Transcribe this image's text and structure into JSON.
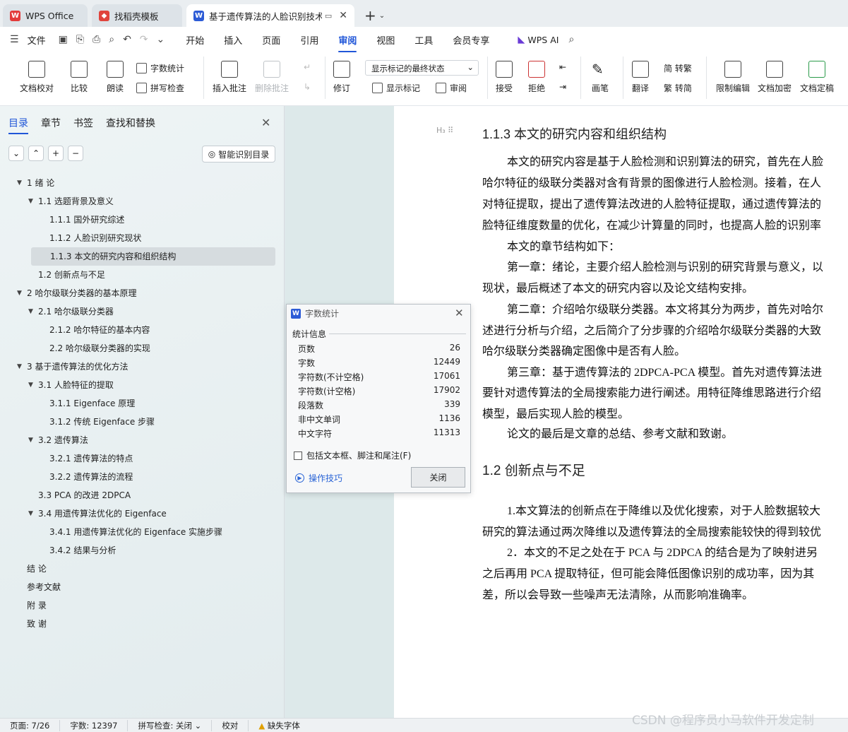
{
  "tabs": [
    {
      "label": "WPS Office"
    },
    {
      "label": "找稻壳模板"
    },
    {
      "label": "基于遗传算法的人脸识别技术"
    }
  ],
  "menu": {
    "file": "文件",
    "items": [
      "开始",
      "插入",
      "页面",
      "引用",
      "审阅",
      "视图",
      "工具",
      "会员专享"
    ],
    "active": "审阅",
    "wps_ai": "WPS AI"
  },
  "ribbon": {
    "doc_check": "文档校对",
    "compare": "比较",
    "read_aloud": "朗读",
    "word_count": "字数统计",
    "spell_check": "拼写检查",
    "insert_comment": "插入批注",
    "delete_comment": "删除批注",
    "revise": "修订",
    "markup_state": "显示标记的最终状态",
    "show_markup": "显示标记",
    "review": "审阅",
    "accept": "接受",
    "reject": "拒绝",
    "pen": "画笔",
    "translate": "翻译",
    "trad": "简 转繁",
    "simp": "繁 转简",
    "restrict": "限制编辑",
    "encrypt": "文档加密",
    "finalize": "文档定稿"
  },
  "sidebar": {
    "tabs": [
      "目录",
      "章节",
      "书签",
      "查找和替换"
    ],
    "smart_toc": "智能识别目录",
    "toc": [
      {
        "label": "1 绪 论",
        "level": 0,
        "arrow": true
      },
      {
        "label": "1.1 选题背景及意义",
        "level": 1,
        "arrow": true
      },
      {
        "label": "1.1.1 国外研究综述",
        "level": 2
      },
      {
        "label": "1.1.2 人脸识别研究现状",
        "level": 2
      },
      {
        "label": "1.1.3 本文的研究内容和组织结构",
        "level": 2,
        "selected": true
      },
      {
        "label": "1.2 创新点与不足",
        "level": 1
      },
      {
        "label": "2 哈尔级联分类器的基本原理",
        "level": 0,
        "arrow": true
      },
      {
        "label": "2.1 哈尔级联分类器",
        "level": 1,
        "arrow": true
      },
      {
        "label": "2.1.2 哈尔特征的基本内容",
        "level": 2
      },
      {
        "label": "2.2 哈尔级联分类器的实现",
        "level": 2
      },
      {
        "label": "3 基于遗传算法的优化方法",
        "level": 0,
        "arrow": true
      },
      {
        "label": "3.1 人脸特征的提取",
        "level": 1,
        "arrow": true
      },
      {
        "label": "3.1.1 Eigenface 原理",
        "level": 2
      },
      {
        "label": "3.1.2 传统 Eigenface 步骤",
        "level": 2
      },
      {
        "label": "3.2 遗传算法",
        "level": 1,
        "arrow": true
      },
      {
        "label": "3.2.1 遗传算法的特点",
        "level": 2
      },
      {
        "label": "3.2.2 遗传算法的流程",
        "level": 2
      },
      {
        "label": "3.3 PCA 的改进 2DPCA",
        "level": 1
      },
      {
        "label": "3.4 用遗传算法优化的 Eigenface",
        "level": 1,
        "arrow": true
      },
      {
        "label": "3.4.1 用遗传算法优化的 Eigenface 实施步骤",
        "level": 2
      },
      {
        "label": "3.4.2 结果与分析",
        "level": 2
      },
      {
        "label": "结 论",
        "level": 0
      },
      {
        "label": "参考文献",
        "level": 0
      },
      {
        "label": "附 录",
        "level": 0
      },
      {
        "label": "致 谢",
        "level": 0
      }
    ]
  },
  "document": {
    "heading1": "1.1.3 本文的研究内容和组织结构",
    "para1": [
      "本文的研究内容是基于人脸检测和识别算法的研究，首先在人脸",
      "哈尔特征的级联分类器对含有背景的图像进行人脸检测。接着，在人",
      "对特征提取，提出了遗传算法改进的人脸特征提取，通过遗传算法的",
      "脸特征维度数量的优化，在减少计算量的同时，也提高人脸的识别率"
    ],
    "para2": "本文的章节结构如下：",
    "para3": [
      "第一章：绪论，主要介绍人脸检测与识别的研究背景与意义，以",
      "现状，最后概述了本文的研究内容以及论文结构安排。"
    ],
    "para4": [
      "第二章：介绍哈尔级联分类器。本文将其分为两步，首先对哈尔",
      "述进行分析与介绍，之后简介了分步骤的介绍哈尔级联分类器的大致",
      "哈尔级联分类器确定图像中是否有人脸。"
    ],
    "para5": [
      "第三章：基于遗传算法的 2DPCA-PCA 模型。首先对遗传算法进",
      "要针对遗传算法的全局搜索能力进行阐述。用特征降维思路进行介绍",
      "模型，最后实现人脸的模型。"
    ],
    "para6": "论文的最后是文章的总结、参考文献和致谢。",
    "heading2": "1.2  创新点与不足",
    "para7": [
      "1.本文算法的创新点在于降维以及优化搜索，对于人脸数据较大",
      "研究的算法通过两次降维以及遗传算法的全局搜索能较快的得到较优"
    ],
    "para8": [
      "2．本文的不足之处在于 PCA 与 2DPCA 的结合是为了映射进另",
      "之后再用 PCA 提取特征，但可能会降低图像识别的成功率，因为其",
      "差，所以会导致一些噪声无法清除，从而影响准确率。"
    ]
  },
  "dialog": {
    "title": "字数统计",
    "section": "统计信息",
    "stats": [
      {
        "label": "页数",
        "value": "26"
      },
      {
        "label": "字数",
        "value": "12449"
      },
      {
        "label": "字符数(不计空格)",
        "value": "17061"
      },
      {
        "label": "字符数(计空格)",
        "value": "17902"
      },
      {
        "label": "段落数",
        "value": "339"
      },
      {
        "label": "非中文单词",
        "value": "1136"
      },
      {
        "label": "中文字符",
        "value": "11313"
      }
    ],
    "checkbox": "包括文本框、脚注和尾注(F)",
    "tips": "操作技巧",
    "close": "关闭"
  },
  "status": {
    "page": "页面: 7/26",
    "words": "字数: 12397",
    "spell": "拼写检查: 关闭",
    "proof": "校对",
    "missing_font": "缺失字体"
  },
  "watermark": "CSDN @程序员小马软件开发定制",
  "colors": {
    "accent": "#2056d8",
    "wps_red": "#e33b3b"
  }
}
